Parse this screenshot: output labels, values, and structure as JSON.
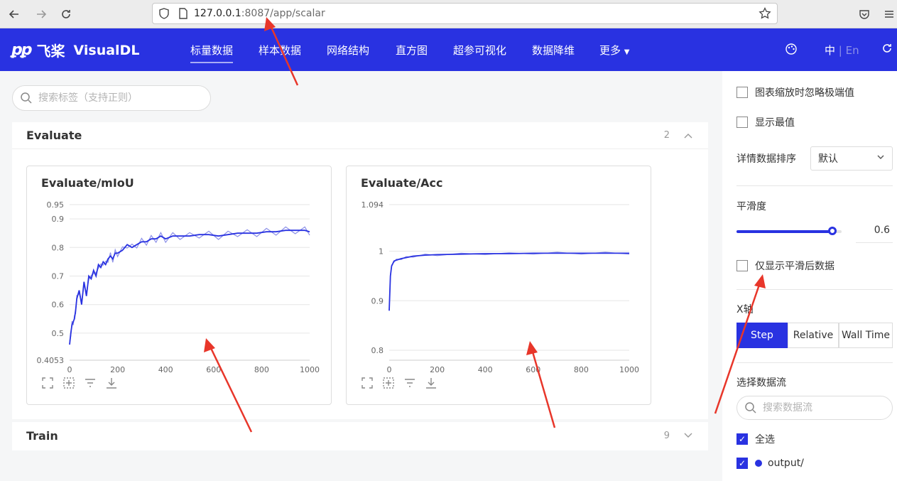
{
  "browser": {
    "url_host": "127.0.0.1",
    "url_rest": ":8087/app/scalar"
  },
  "header": {
    "logo_cn": "飞桨",
    "logo_en": "VisualDL",
    "nav": [
      "标量数据",
      "样本数据",
      "网络结构",
      "直方图",
      "超参可视化",
      "数据降维",
      "更多"
    ],
    "lang_zh": "中",
    "lang_sep": "|",
    "lang_en": "En"
  },
  "search": {
    "placeholder": "搜索标签（支持正则）"
  },
  "groups": [
    {
      "title": "Evaluate",
      "count": "2"
    },
    {
      "title": "Train",
      "count": "9"
    }
  ],
  "cards": [
    {
      "title": "Evaluate/mIoU"
    },
    {
      "title": "Evaluate/Acc"
    }
  ],
  "chart_data": [
    {
      "type": "line",
      "title": "Evaluate/mIoU",
      "xlabel": "",
      "ylabel": "",
      "xlim": [
        0,
        1000
      ],
      "ylim": [
        0.4053,
        0.95
      ],
      "x_ticks": [
        "0",
        "200",
        "400",
        "600",
        "800",
        "1000"
      ],
      "y_ticks": [
        "0.95",
        "0.9",
        "0.8",
        "0.7",
        "0.6",
        "0.5",
        "0.4053"
      ],
      "series": [
        {
          "x": [
            0,
            5,
            10,
            15,
            20,
            25,
            30,
            40,
            50,
            60,
            70,
            80,
            90,
            100,
            110,
            120,
            130,
            140,
            150,
            160,
            170,
            180,
            190,
            200,
            220,
            240,
            260,
            280,
            300,
            320,
            340,
            360,
            380,
            400,
            430,
            460,
            500,
            540,
            580,
            620,
            660,
            700,
            740,
            780,
            820,
            860,
            900,
            940,
            980,
            1000
          ],
          "y": [
            0.46,
            0.5,
            0.53,
            0.54,
            0.55,
            0.58,
            0.62,
            0.65,
            0.6,
            0.68,
            0.63,
            0.7,
            0.69,
            0.72,
            0.7,
            0.74,
            0.73,
            0.75,
            0.74,
            0.76,
            0.77,
            0.76,
            0.78,
            0.78,
            0.79,
            0.81,
            0.8,
            0.81,
            0.82,
            0.82,
            0.83,
            0.83,
            0.84,
            0.83,
            0.84,
            0.84,
            0.84,
            0.845,
            0.845,
            0.84,
            0.845,
            0.85,
            0.85,
            0.85,
            0.855,
            0.855,
            0.86,
            0.86,
            0.86,
            0.855
          ]
        }
      ],
      "legend": "none",
      "grid": true
    },
    {
      "type": "line",
      "title": "Evaluate/Acc",
      "xlabel": "",
      "ylabel": "",
      "xlim": [
        0,
        1000
      ],
      "ylim": [
        0.78,
        1.094
      ],
      "x_ticks": [
        "0",
        "200",
        "400",
        "600",
        "800",
        "1000"
      ],
      "y_ticks": [
        "1.094",
        "1",
        "0.9",
        "0.8"
      ],
      "series": [
        {
          "x": [
            0,
            5,
            10,
            20,
            30,
            50,
            70,
            100,
            150,
            200,
            300,
            400,
            500,
            600,
            700,
            800,
            900,
            1000
          ],
          "y": [
            0.88,
            0.95,
            0.97,
            0.98,
            0.982,
            0.985,
            0.987,
            0.99,
            0.992,
            0.993,
            0.994,
            0.995,
            0.995,
            0.996,
            0.996,
            0.996,
            0.996,
            0.996
          ]
        }
      ],
      "legend": "none",
      "grid": true
    }
  ],
  "side": {
    "ignore_outliers": "图表缩放时忽略极端值",
    "show_extrema": "显示最值",
    "sort_label": "详情数据排序",
    "sort_value": "默认",
    "smoothing_label": "平滑度",
    "smoothing_value": "0.6",
    "smoothing_fraction": 0.6,
    "smoothed_only": "仅显示平滑后数据",
    "xaxis_label": "X轴",
    "xaxis_options": [
      "Step",
      "Relative",
      "Wall Time"
    ],
    "stream_label": "选择数据流",
    "stream_placeholder": "搜索数据流",
    "select_all": "全选",
    "stream_item": "output/"
  },
  "colors": {
    "brand": "#2932e1",
    "line": "#2932e1",
    "line_raw": "#8c90e8",
    "annotation": "#e8362a"
  }
}
